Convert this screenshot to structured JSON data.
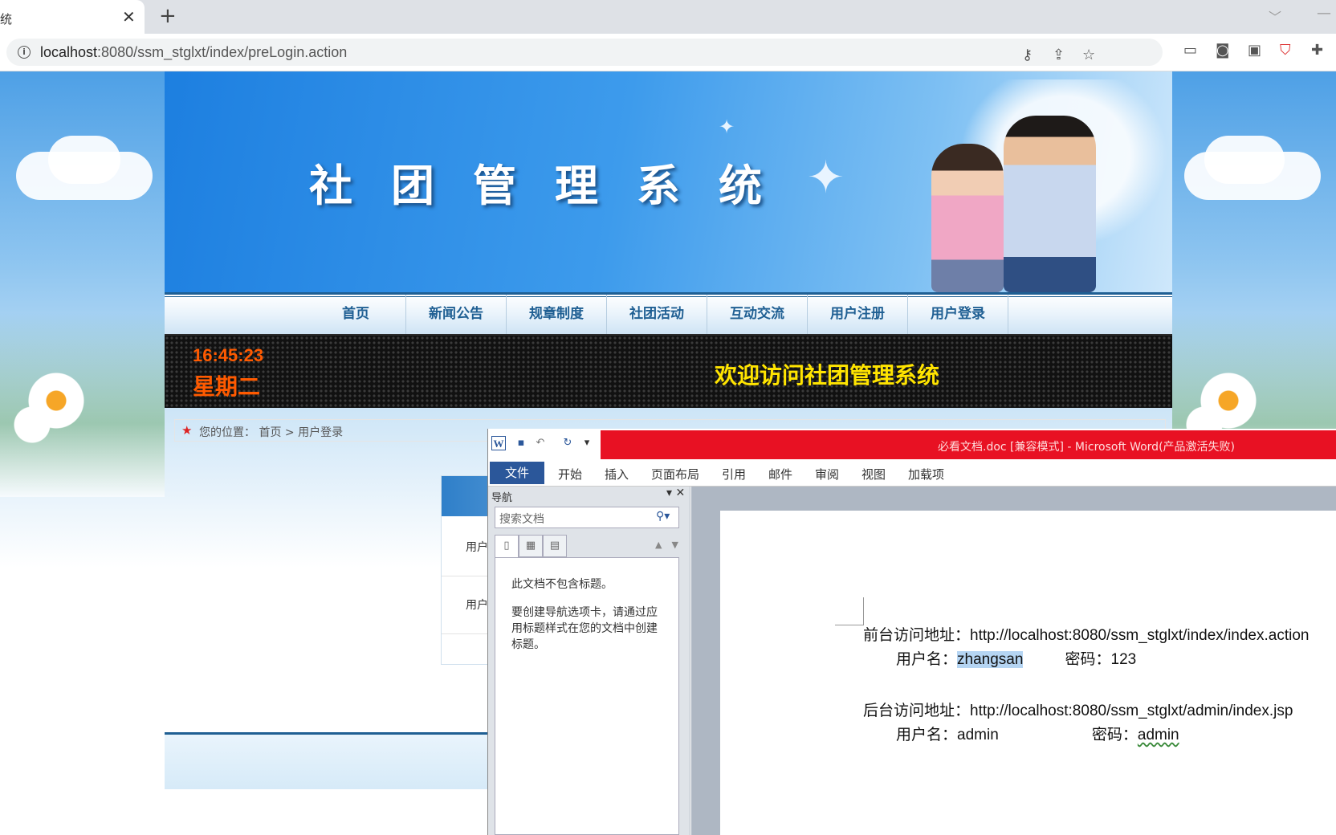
{
  "browser": {
    "tab_title": "统",
    "tab_close": "✕",
    "new_tab": "+",
    "url_host": "localhost",
    "url_rest": ":8080/ssm_stglxt/index/preLogin.action"
  },
  "site": {
    "banner_title": "社团管理系统",
    "nav": [
      "首页",
      "新闻公告",
      "规章制度",
      "社团活动",
      "互动交流",
      "用户注册",
      "用户登录"
    ],
    "clock_time": "16:45:23",
    "clock_day": "星期二",
    "welcome": "欢迎访问社团管理系统",
    "breadcrumb_label": "您的位置：",
    "breadcrumb_home": "首页",
    "breadcrumb_sep": ">",
    "breadcrumb_current": "用户登录",
    "login_label_1": "用户",
    "login_label_2": "用户"
  },
  "word": {
    "title": "必看文档.doc [兼容模式] - Microsoft Word(产品激活失败)",
    "w_logo": "W",
    "ribbon_tabs": [
      "文件",
      "开始",
      "插入",
      "页面布局",
      "引用",
      "邮件",
      "审阅",
      "视图",
      "加载项"
    ],
    "nav_pane": {
      "title": "导航",
      "search_placeholder": "搜索文档",
      "msg_no_headings": "此文档不包含标题。",
      "msg_hint": "要创建导航选项卡，请通过应用标题样式在您的文档中创建标题。"
    },
    "doc": {
      "front_label": "前台访问地址：",
      "front_url": "http://localhost:8080/ssm_stglxt/index/index.action",
      "user_label_1": "用户名：",
      "user_value_1": "zhangsan",
      "pwd_label_1": "密码：",
      "pwd_value_1": "123",
      "back_label": "后台访问地址：",
      "back_url": "http://localhost:8080/ssm_stglxt/admin/index.jsp",
      "user_label_2": "用户名：",
      "user_value_2": "admin",
      "pwd_label_2": "密码：",
      "pwd_value_2": "admin"
    }
  },
  "colors": {
    "nav_text": "#1f5f93",
    "led_time": "#ff5a00",
    "led_welcome": "#ffe400",
    "word_title_bar": "#e81123",
    "word_file_tab": "#2b579a"
  }
}
